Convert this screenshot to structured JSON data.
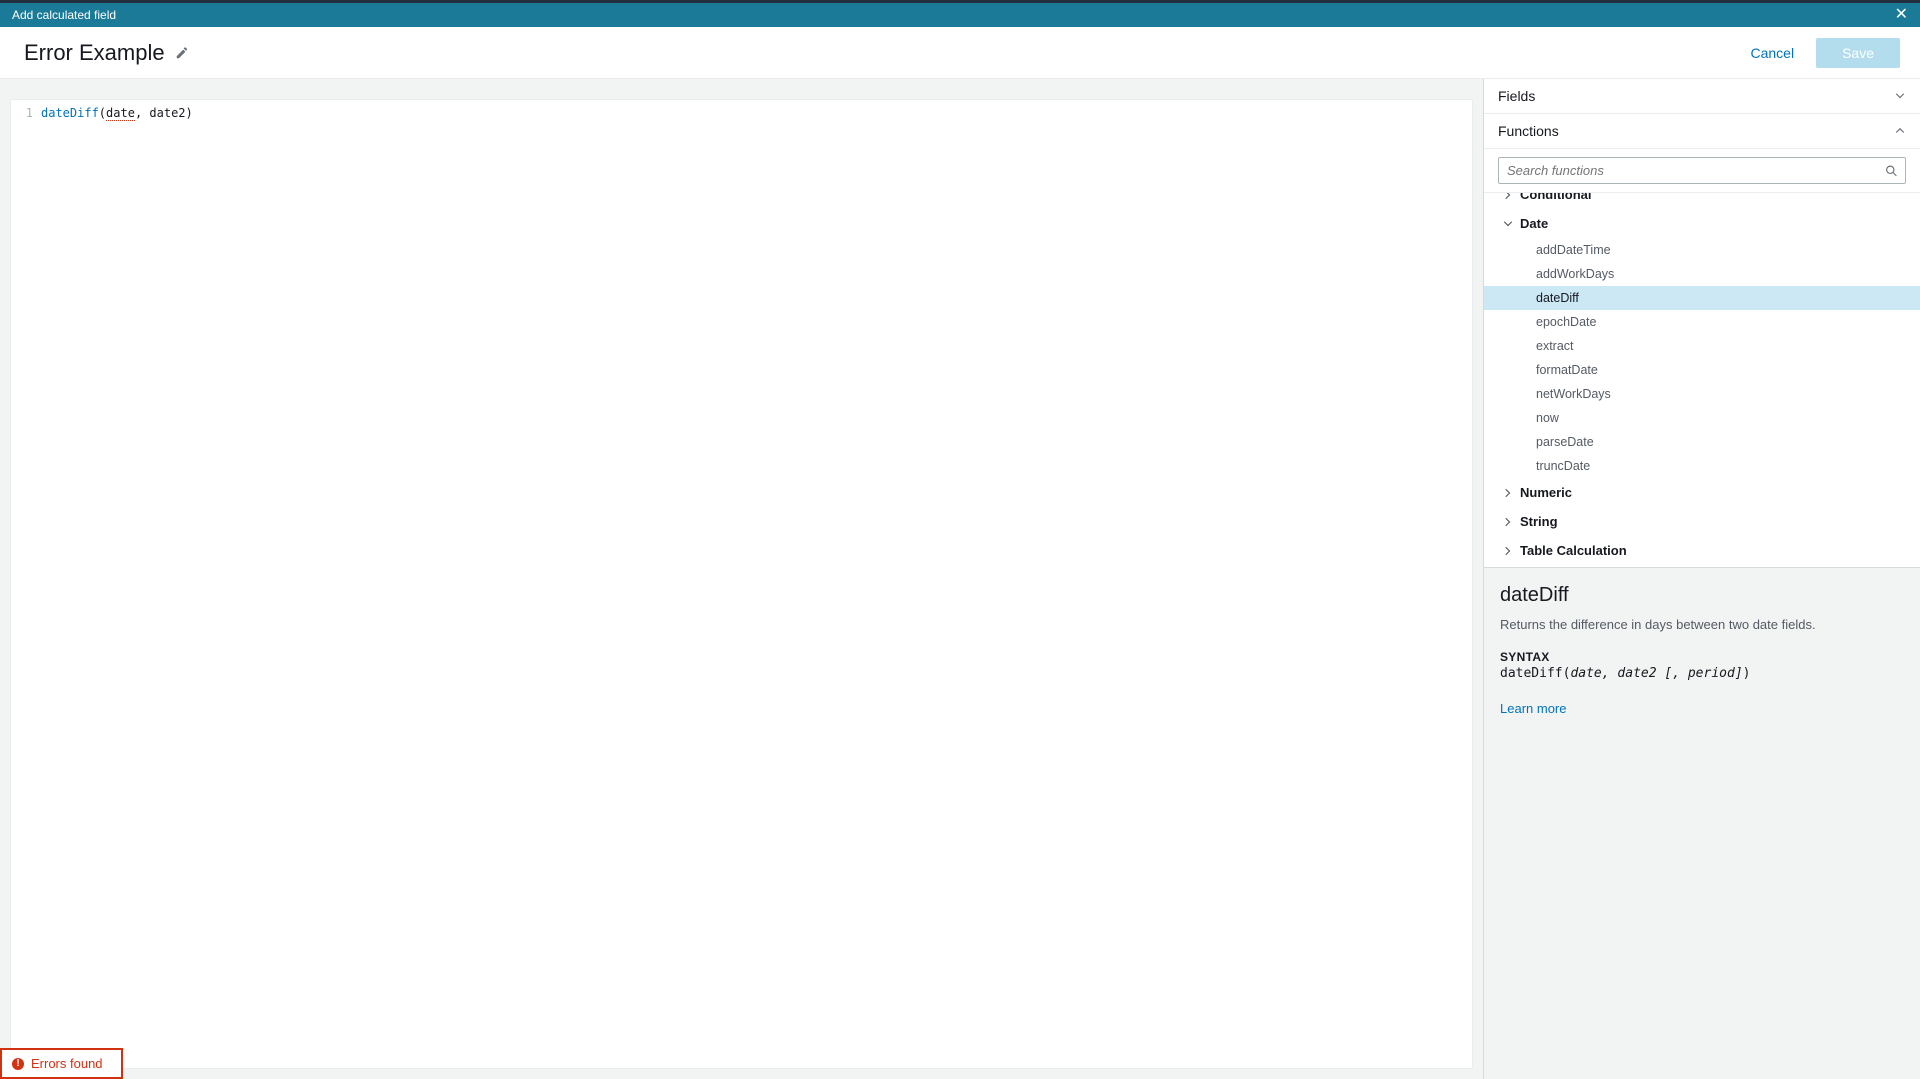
{
  "titlebar": {
    "title": "Add calculated field"
  },
  "header": {
    "field_name": "Error Example",
    "cancel_label": "Cancel",
    "save_label": "Save"
  },
  "editor": {
    "line_no": "1",
    "fn_token": "dateDiff",
    "open_paren": "(",
    "arg1": "date",
    "comma_sp": ", ",
    "arg2": "date2",
    "close_paren": ")"
  },
  "error_chip": "Errors found",
  "side": {
    "fields_label": "Fields",
    "functions_label": "Functions",
    "search_placeholder": "Search functions",
    "cat_conditional": "Conditional",
    "cat_date": "Date",
    "cat_numeric": "Numeric",
    "cat_string": "String",
    "cat_tablecalc": "Table Calculation",
    "date_fns": {
      "addDateTime": "addDateTime",
      "addWorkDays": "addWorkDays",
      "dateDiff": "dateDiff",
      "epochDate": "epochDate",
      "extract": "extract",
      "formatDate": "formatDate",
      "netWorkDays": "netWorkDays",
      "now": "now",
      "parseDate": "parseDate",
      "truncDate": "truncDate"
    }
  },
  "doc": {
    "title": "dateDiff",
    "desc": "Returns the difference in days between two date fields.",
    "syntax_label": "SYNTAX",
    "syntax_fn": "dateDiff(",
    "syntax_args": "date, date2 [, period]",
    "syntax_close": ")",
    "learn_more": "Learn more"
  }
}
